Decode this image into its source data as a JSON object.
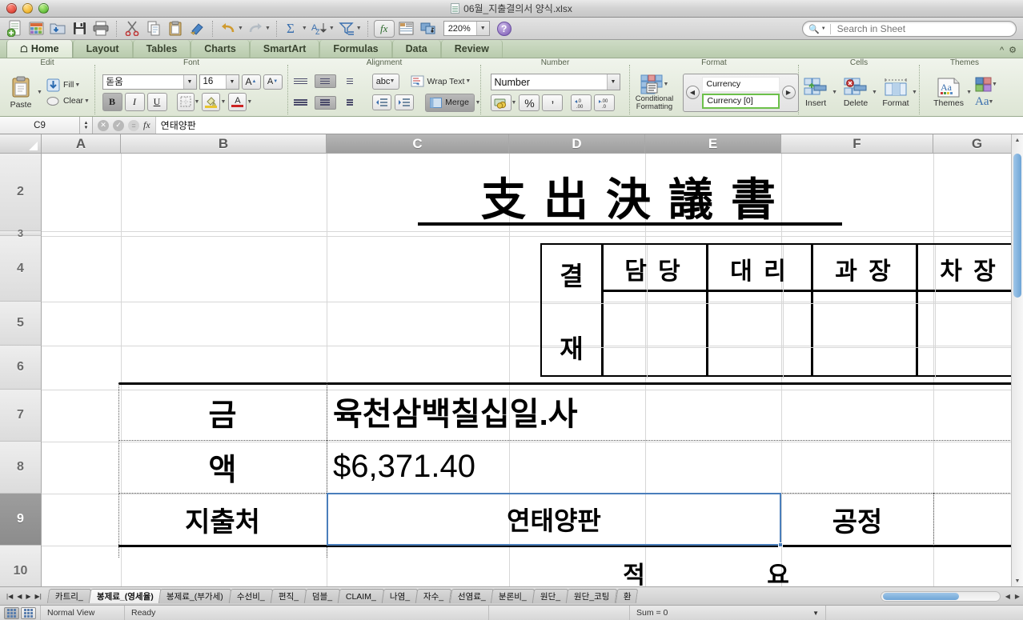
{
  "window": {
    "title": "06월_지출결의서 양식.xlsx",
    "doc_icon": "spreadsheet-document-icon"
  },
  "toolbar": {
    "icons": [
      "new-document-icon",
      "open-template-icon",
      "open-folder-icon",
      "save-icon",
      "print-icon",
      "cut-icon",
      "copy-icon",
      "paste-icon",
      "format-painter-icon",
      "undo-icon",
      "redo-icon",
      "autosum-icon",
      "sort-icon",
      "filter-icon",
      "formula-builder-icon",
      "sheet-view-icon",
      "media-browser-icon"
    ],
    "zoom_value": "220%",
    "help_label": "?"
  },
  "search": {
    "placeholder": "Search in Sheet",
    "value": ""
  },
  "ribbon_tabs": [
    {
      "label": "Home",
      "active": true
    },
    {
      "label": "Layout",
      "active": false
    },
    {
      "label": "Tables",
      "active": false
    },
    {
      "label": "Charts",
      "active": false
    },
    {
      "label": "SmartArt",
      "active": false
    },
    {
      "label": "Formulas",
      "active": false
    },
    {
      "label": "Data",
      "active": false
    },
    {
      "label": "Review",
      "active": false
    }
  ],
  "ribbon": {
    "groups": {
      "edit": {
        "label": "Edit",
        "paste_label": "Paste",
        "fill_label": "Fill",
        "clear_label": "Clear"
      },
      "font": {
        "label": "Font",
        "font_name": "돋움",
        "font_size": "16",
        "grow_label": "A",
        "shrink_label": "A",
        "bold_label": "B",
        "italic_label": "I",
        "underline_label": "U",
        "borders_label": "borders",
        "fill_color_label": "A",
        "font_color_label": "A"
      },
      "alignment": {
        "label": "Alignment",
        "orientation_label": "abc",
        "wrap_label": "Wrap Text",
        "merge_label": "Merge"
      },
      "number": {
        "label": "Number",
        "format_value": "Number",
        "percent_label": "%",
        "comma_label": ",",
        "inc_dec_label": ".00",
        "dec_dec_label": ".00"
      },
      "format": {
        "label": "Format",
        "conditional_label_1": "Conditional",
        "conditional_label_2": "Formatting",
        "styles": [
          {
            "name": "Currency",
            "selected": false
          },
          {
            "name": "Currency [0]",
            "selected": true
          }
        ]
      },
      "cells": {
        "label": "Cells",
        "insert_label": "Insert",
        "delete_label": "Delete",
        "format_label": "Format"
      },
      "themes": {
        "label": "Themes",
        "themes_label": "Themes",
        "colors_label": "colors",
        "fonts_label": "Aa"
      }
    }
  },
  "formula_bar": {
    "name_box": "C9",
    "content": "연태양판",
    "cancel_icon": "cancel-icon",
    "accept_icon": "accept-icon",
    "function_icon": "fx"
  },
  "sheet": {
    "columns": [
      {
        "label": "A",
        "selected": false
      },
      {
        "label": "B",
        "selected": false
      },
      {
        "label": "C",
        "selected": true
      },
      {
        "label": "D",
        "selected": true
      },
      {
        "label": "E",
        "selected": true
      },
      {
        "label": "F",
        "selected": false
      },
      {
        "label": "G",
        "selected": false
      }
    ],
    "rows": [
      {
        "label": "2",
        "selected": false
      },
      {
        "label": "3",
        "selected": false
      },
      {
        "label": "4",
        "selected": false
      },
      {
        "label": "5",
        "selected": false
      },
      {
        "label": "6",
        "selected": false
      },
      {
        "label": "7",
        "selected": false
      },
      {
        "label": "8",
        "selected": false
      },
      {
        "label": "9",
        "selected": true
      },
      {
        "label": "10",
        "selected": false
      }
    ],
    "cells": {
      "title": "支  出  決  議  書",
      "approval_label_1": "결",
      "approval_label_2": "재",
      "approval_cols": [
        "담 당",
        "대 리",
        "과 장",
        "차 장"
      ],
      "amount_label_1": "금",
      "amount_label_2": "액",
      "amount_hangul": "육천삼백칠십일.사",
      "amount_value": "$6,371.40",
      "payee_label": "지출처",
      "payee_value": "연태양판",
      "process_label": "공정",
      "summary_label_1": "적",
      "summary_label_2": "요"
    },
    "selected_cell": "C9"
  },
  "sheet_tabs": [
    {
      "label": "카트리_",
      "active": false
    },
    {
      "label": "봉제료_(영세율)",
      "active": true
    },
    {
      "label": "봉제료_(부가세)",
      "active": false
    },
    {
      "label": "수선비_",
      "active": false
    },
    {
      "label": "편직_",
      "active": false
    },
    {
      "label": "덤블_",
      "active": false
    },
    {
      "label": "CLAIM_",
      "active": false
    },
    {
      "label": "나염_",
      "active": false
    },
    {
      "label": "자수_",
      "active": false
    },
    {
      "label": "선염료_",
      "active": false
    },
    {
      "label": "분론비_",
      "active": false
    },
    {
      "label": "원단_",
      "active": false
    },
    {
      "label": "원단_코팅",
      "active": false
    },
    {
      "label": "환",
      "active": false
    }
  ],
  "status_bar": {
    "view_label": "Normal View",
    "state_label": "Ready",
    "sum_label": "Sum = 0"
  },
  "colors": {
    "ribbon_green": "#dde5d4",
    "selection_blue": "#4a7ebb",
    "style_selected_green": "#6cc04a"
  }
}
